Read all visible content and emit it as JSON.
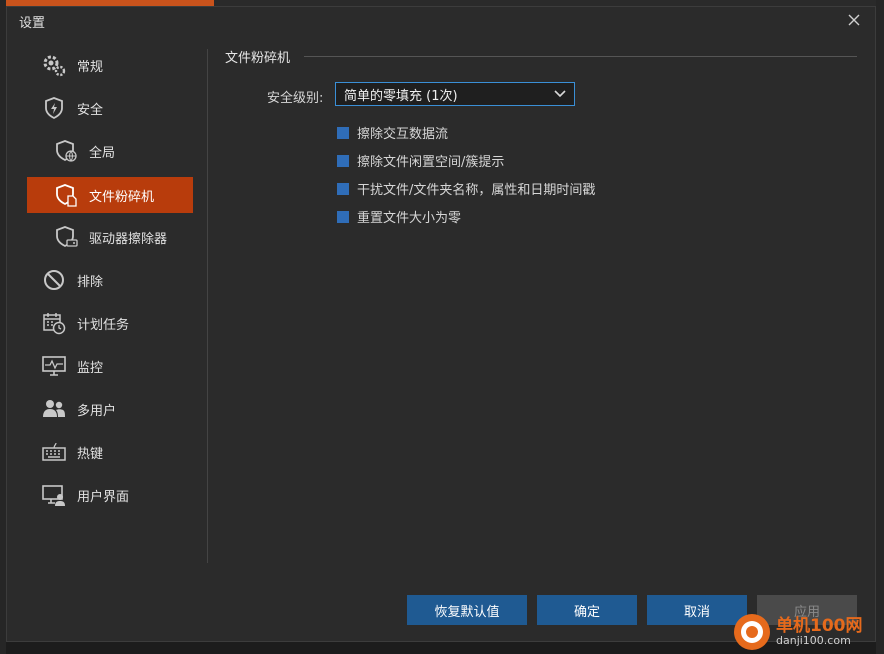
{
  "dialog": {
    "title": "设置"
  },
  "sidebar": {
    "items": [
      {
        "label": "常规",
        "icon": "gears-icon"
      },
      {
        "label": "安全",
        "icon": "shield-bolt-icon"
      },
      {
        "label": "全局",
        "icon": "shield-globe-icon"
      },
      {
        "label": "文件粉碎机",
        "icon": "shield-file-icon",
        "active": true
      },
      {
        "label": "驱动器擦除器",
        "icon": "shield-drive-icon"
      },
      {
        "label": "排除",
        "icon": "no-entry-icon"
      },
      {
        "label": "计划任务",
        "icon": "calendar-clock-icon"
      },
      {
        "label": "监控",
        "icon": "monitor-icon"
      },
      {
        "label": "多用户",
        "icon": "users-icon"
      },
      {
        "label": "热键",
        "icon": "keyboard-icon"
      },
      {
        "label": "用户界面",
        "icon": "display-user-icon"
      }
    ]
  },
  "main": {
    "section_title": "文件粉碎机",
    "security_level_label": "安全级别:",
    "security_level_value": "简单的零填充 (1次)",
    "options": [
      "擦除交互数据流",
      "擦除文件闲置空间/簇提示",
      "干扰文件/文件夹名称，属性和日期时间戳",
      "重置文件大小为零"
    ]
  },
  "buttons": {
    "restore": "恢复默认值",
    "ok": "确定",
    "cancel": "取消",
    "apply": "应用"
  },
  "watermark": {
    "line1": "单机100网",
    "line2": "danji100.com"
  },
  "colors": {
    "accent_active": "#b83c0c",
    "button_blue": "#1f5a92",
    "checkbox_blue": "#2f6db8",
    "select_border": "#3a8fd6"
  }
}
